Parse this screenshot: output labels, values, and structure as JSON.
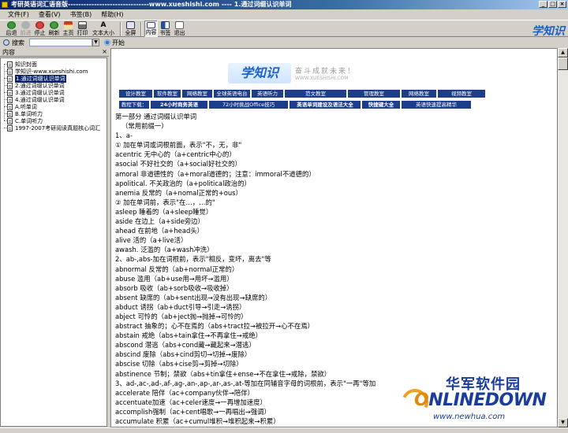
{
  "window": {
    "title": "考研英语词汇语音版-------------------------------www.xueshishi.com ---- 1.通过词缀认识单词",
    "min_label": "_",
    "max_label": "□",
    "close_label": "×"
  },
  "menu": [
    "文件(F)",
    "查看(V)",
    "书签(B)",
    "帮助(H)"
  ],
  "toolbar": {
    "back": "后退",
    "forward": "前进",
    "stop": "停止",
    "refresh": "刷新",
    "home": "主页",
    "print": "打印",
    "font_size": "文本大小",
    "font_glyph": "A",
    "fullscreen": "全屏",
    "contents": "内容",
    "bookmark": "书签",
    "exit": "退出",
    "logo": "学知识"
  },
  "search": {
    "label": "搜索",
    "dropdown_arrow": "▼",
    "start_label": "开始"
  },
  "left_pane": {
    "header": "内容",
    "close": "×",
    "items": [
      {
        "label": "知识封面",
        "selected": false
      },
      {
        "label": "学知识-www.xueshishi.com",
        "selected": false
      },
      {
        "label": "1.通过词缀认识单词",
        "selected": true
      },
      {
        "label": "2.通过词缀认识单词",
        "selected": false
      },
      {
        "label": "3.通过词缀认识单词",
        "selected": false
      },
      {
        "label": "4.通过词缀认识单词",
        "selected": false
      },
      {
        "label": "A.听单词",
        "selected": false
      },
      {
        "label": "B.单词听力",
        "selected": false
      },
      {
        "label": "C.单词听力",
        "selected": false
      },
      {
        "label": "1997-2007考研阅读真题核心词汇",
        "selected": false
      }
    ]
  },
  "banner": {
    "logo": "学知识",
    "slogan": "奋斗成就未来！",
    "url": "WWW.XUESHISHI.COM"
  },
  "nav_row1": [
    "设计教室",
    "软件教室",
    "网络教室",
    "全球英语电台",
    "英语听力",
    "范文教室",
    "管理教室",
    "网络教室",
    "视频教室"
  ],
  "nav_row2": [
    "教程下载：",
    "24小时商务英语",
    "72小时挑战Office技巧",
    "英语单词建设及语法大全",
    "快捷键大全",
    "英语快速提高精华"
  ],
  "article": [
    "第一部分  通过词缀认识单词",
    "（常用前缀一）",
    "1、a-",
    "① 加在单词或词根前面，表示\"不，无，非\"",
    "acentric 无中心的（a+centric中心的）",
    "asocial 不好社交的（a+social好社交的）",
    "amoral 非道德性的（a+moral道德的；注意：immoral不道德的）",
    "apolitical. 不关政治的（a+political政治的）",
    "anemia 反常的（a+nomal正常的+ous）",
    "② 加在单词前，表示\"在…，…的\"",
    "asleep 睡着的（a+sleep睡觉）",
    "aside 在边上（a+side旁边）",
    "ahead 在前地（a+head头）",
    "alive 活的（a+live活）",
    "awash. 泛滥的（a+wash冲洗）",
    "2、ab-,abs-加在词根前，表示\"相反，变坏，离去\"等",
    "abnormal 反常的（ab+normal正常的）",
    "abuse 滥用（ab+use用→用坏→滥用）",
    "absorb 吸收（ab+sorb吸收→吸收掉）",
    "absent 缺席的（ab+sent出现→没有出现→缺席的）",
    "abduct 诱拐（ab+duct引导→引走→诱拐）",
    "abject 可怜的（ab+ject抛→抛掉→可怜的）",
    "abstract 抽象的；心不在焉的（abs+tract拉→被拉开→心不在焉）",
    "abstain 戒绝（abs+tain拿住→不再拿住→戒绝）",
    "abscond 潜逃（abs+cond藏→藏起来→潜逃）",
    "abscind 废除（abs+cind剪切→切掉→废除）",
    "abscise 切除（abs+cise剪→剪掉→切除）",
    "abstinence 节制；禁欲（abs+tin拿住+ense→不在拿住→戒除，禁欲）",
    "3、ad-,ac-,ad-,af-,ag-,an-,ap-,ar-,as-,at-等加在同辅音字母的词根前，表示\"一再\"等加",
    "accelerate 陪伴（ac+company伙伴→陪伴）",
    "accentuate加速（ac+celer速度→一再增加速度）",
    "accomplish强制（ac+cent唱歌→一再唱出→强调）",
    "accumulate 积累（ac+cumul堆积→堆积起来→积累）"
  ],
  "watermark": {
    "cn": "华军软件园",
    "en_a": "O",
    "en_b": "NLINEDOWN",
    "url": "www.newhua.com"
  }
}
